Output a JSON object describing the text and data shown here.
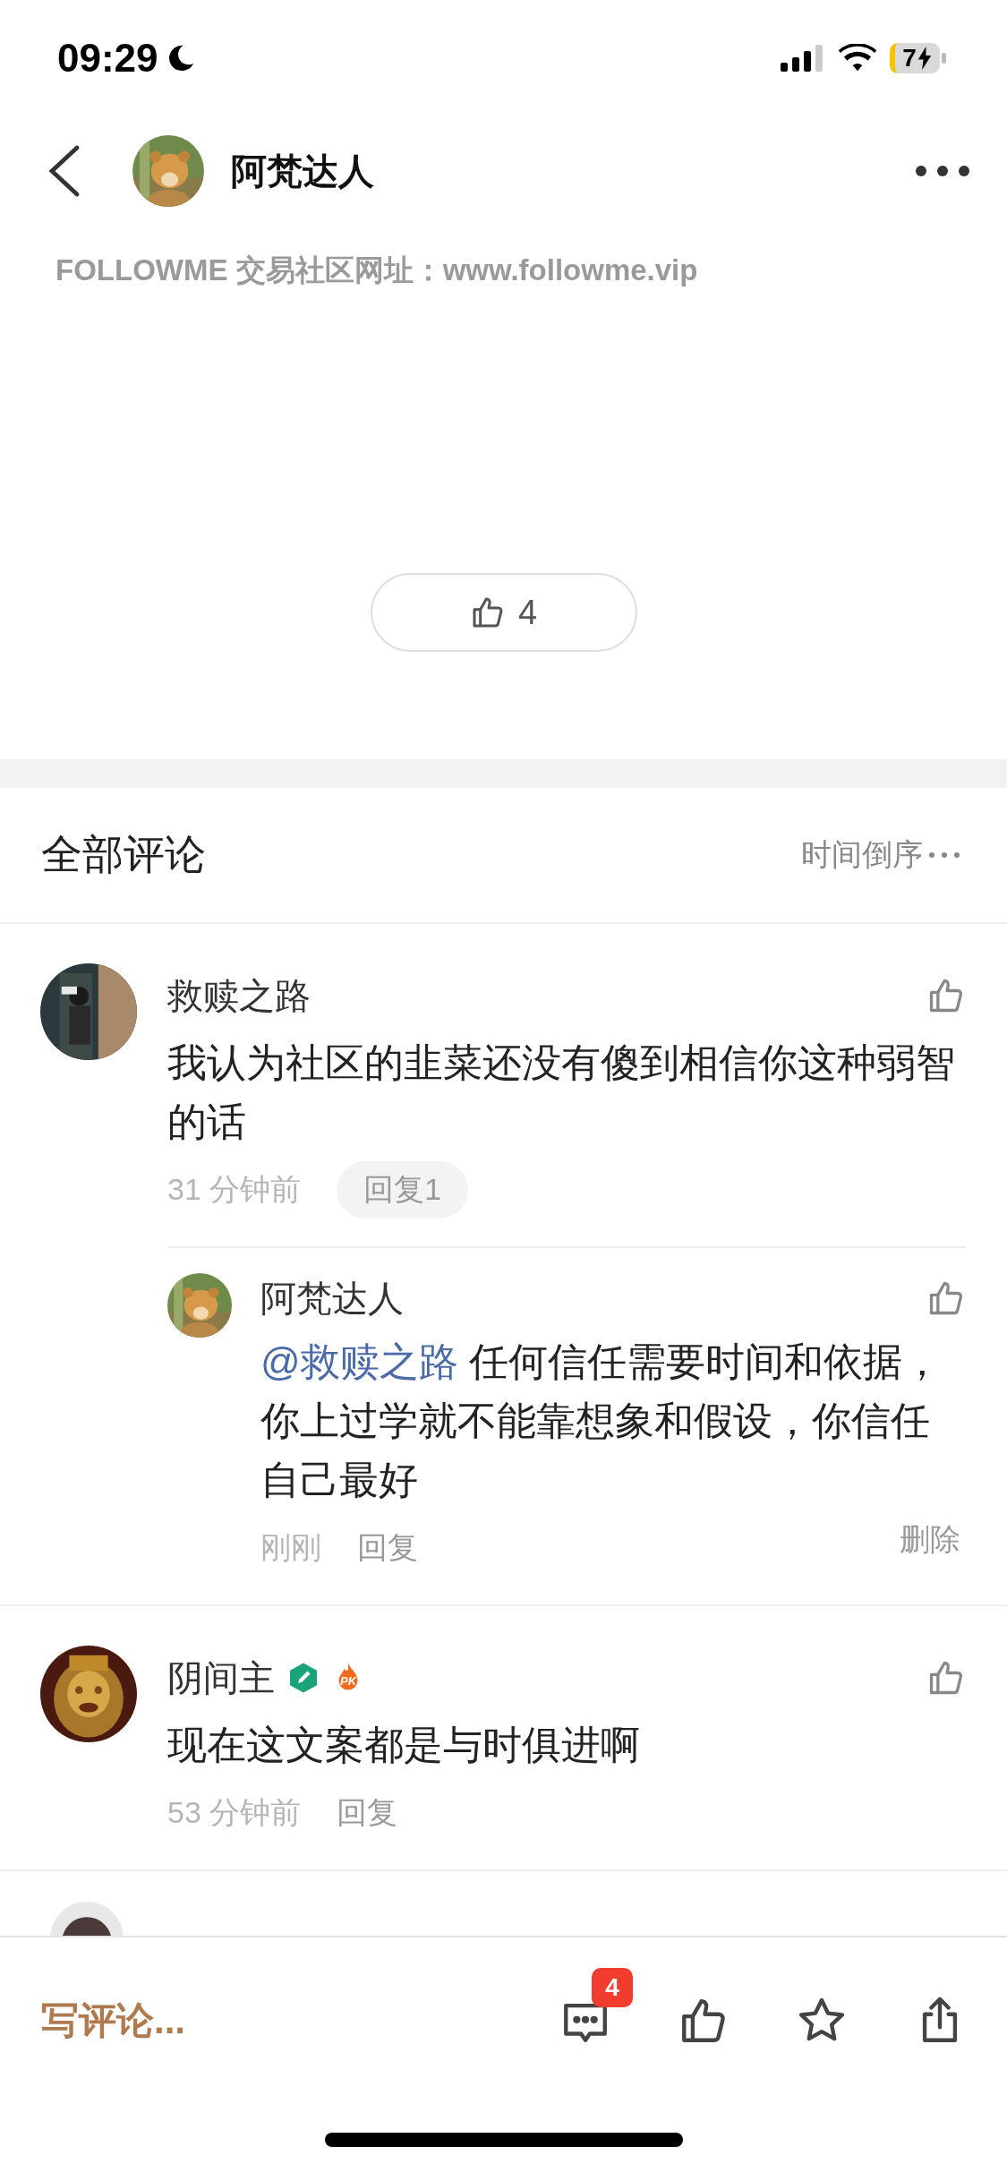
{
  "status_bar": {
    "time": "09:29",
    "battery": "7",
    "charging": true
  },
  "header": {
    "author": "阿梵达人"
  },
  "post": {
    "site_text": "FOLLOWME 交易社区网址：www.followme.vip",
    "like_count": "4"
  },
  "comments_header": {
    "title": "全部评论",
    "sort": "时间倒序"
  },
  "comments": [
    {
      "kind": "comment",
      "name": "救赎之路",
      "text": "我认为社区的韭菜还没有傻到相信你这种弱智的话",
      "time": "31 分钟前",
      "reply_label": "回复1",
      "replies": [
        {
          "kind": "reply",
          "name": "阿梵达人",
          "mention": "@救赎之路",
          "text": "任何信任需要时间和依据，你上过学就不能靠想象和假设，你信任自己最好",
          "time": "刚刚",
          "reply_label": "回复",
          "delete_label": "删除"
        }
      ]
    },
    {
      "kind": "comment",
      "name": "阴间主",
      "badges": [
        {
          "kind": "creator"
        },
        {
          "kind": "pk",
          "label": "PK"
        }
      ],
      "text": "现在这文案都是与时俱进啊",
      "time": "53 分钟前",
      "reply_label": "回复"
    },
    {
      "kind": "cut_off"
    }
  ],
  "bottom_bar": {
    "write_placeholder": "写评论...",
    "comment_count": "4"
  }
}
